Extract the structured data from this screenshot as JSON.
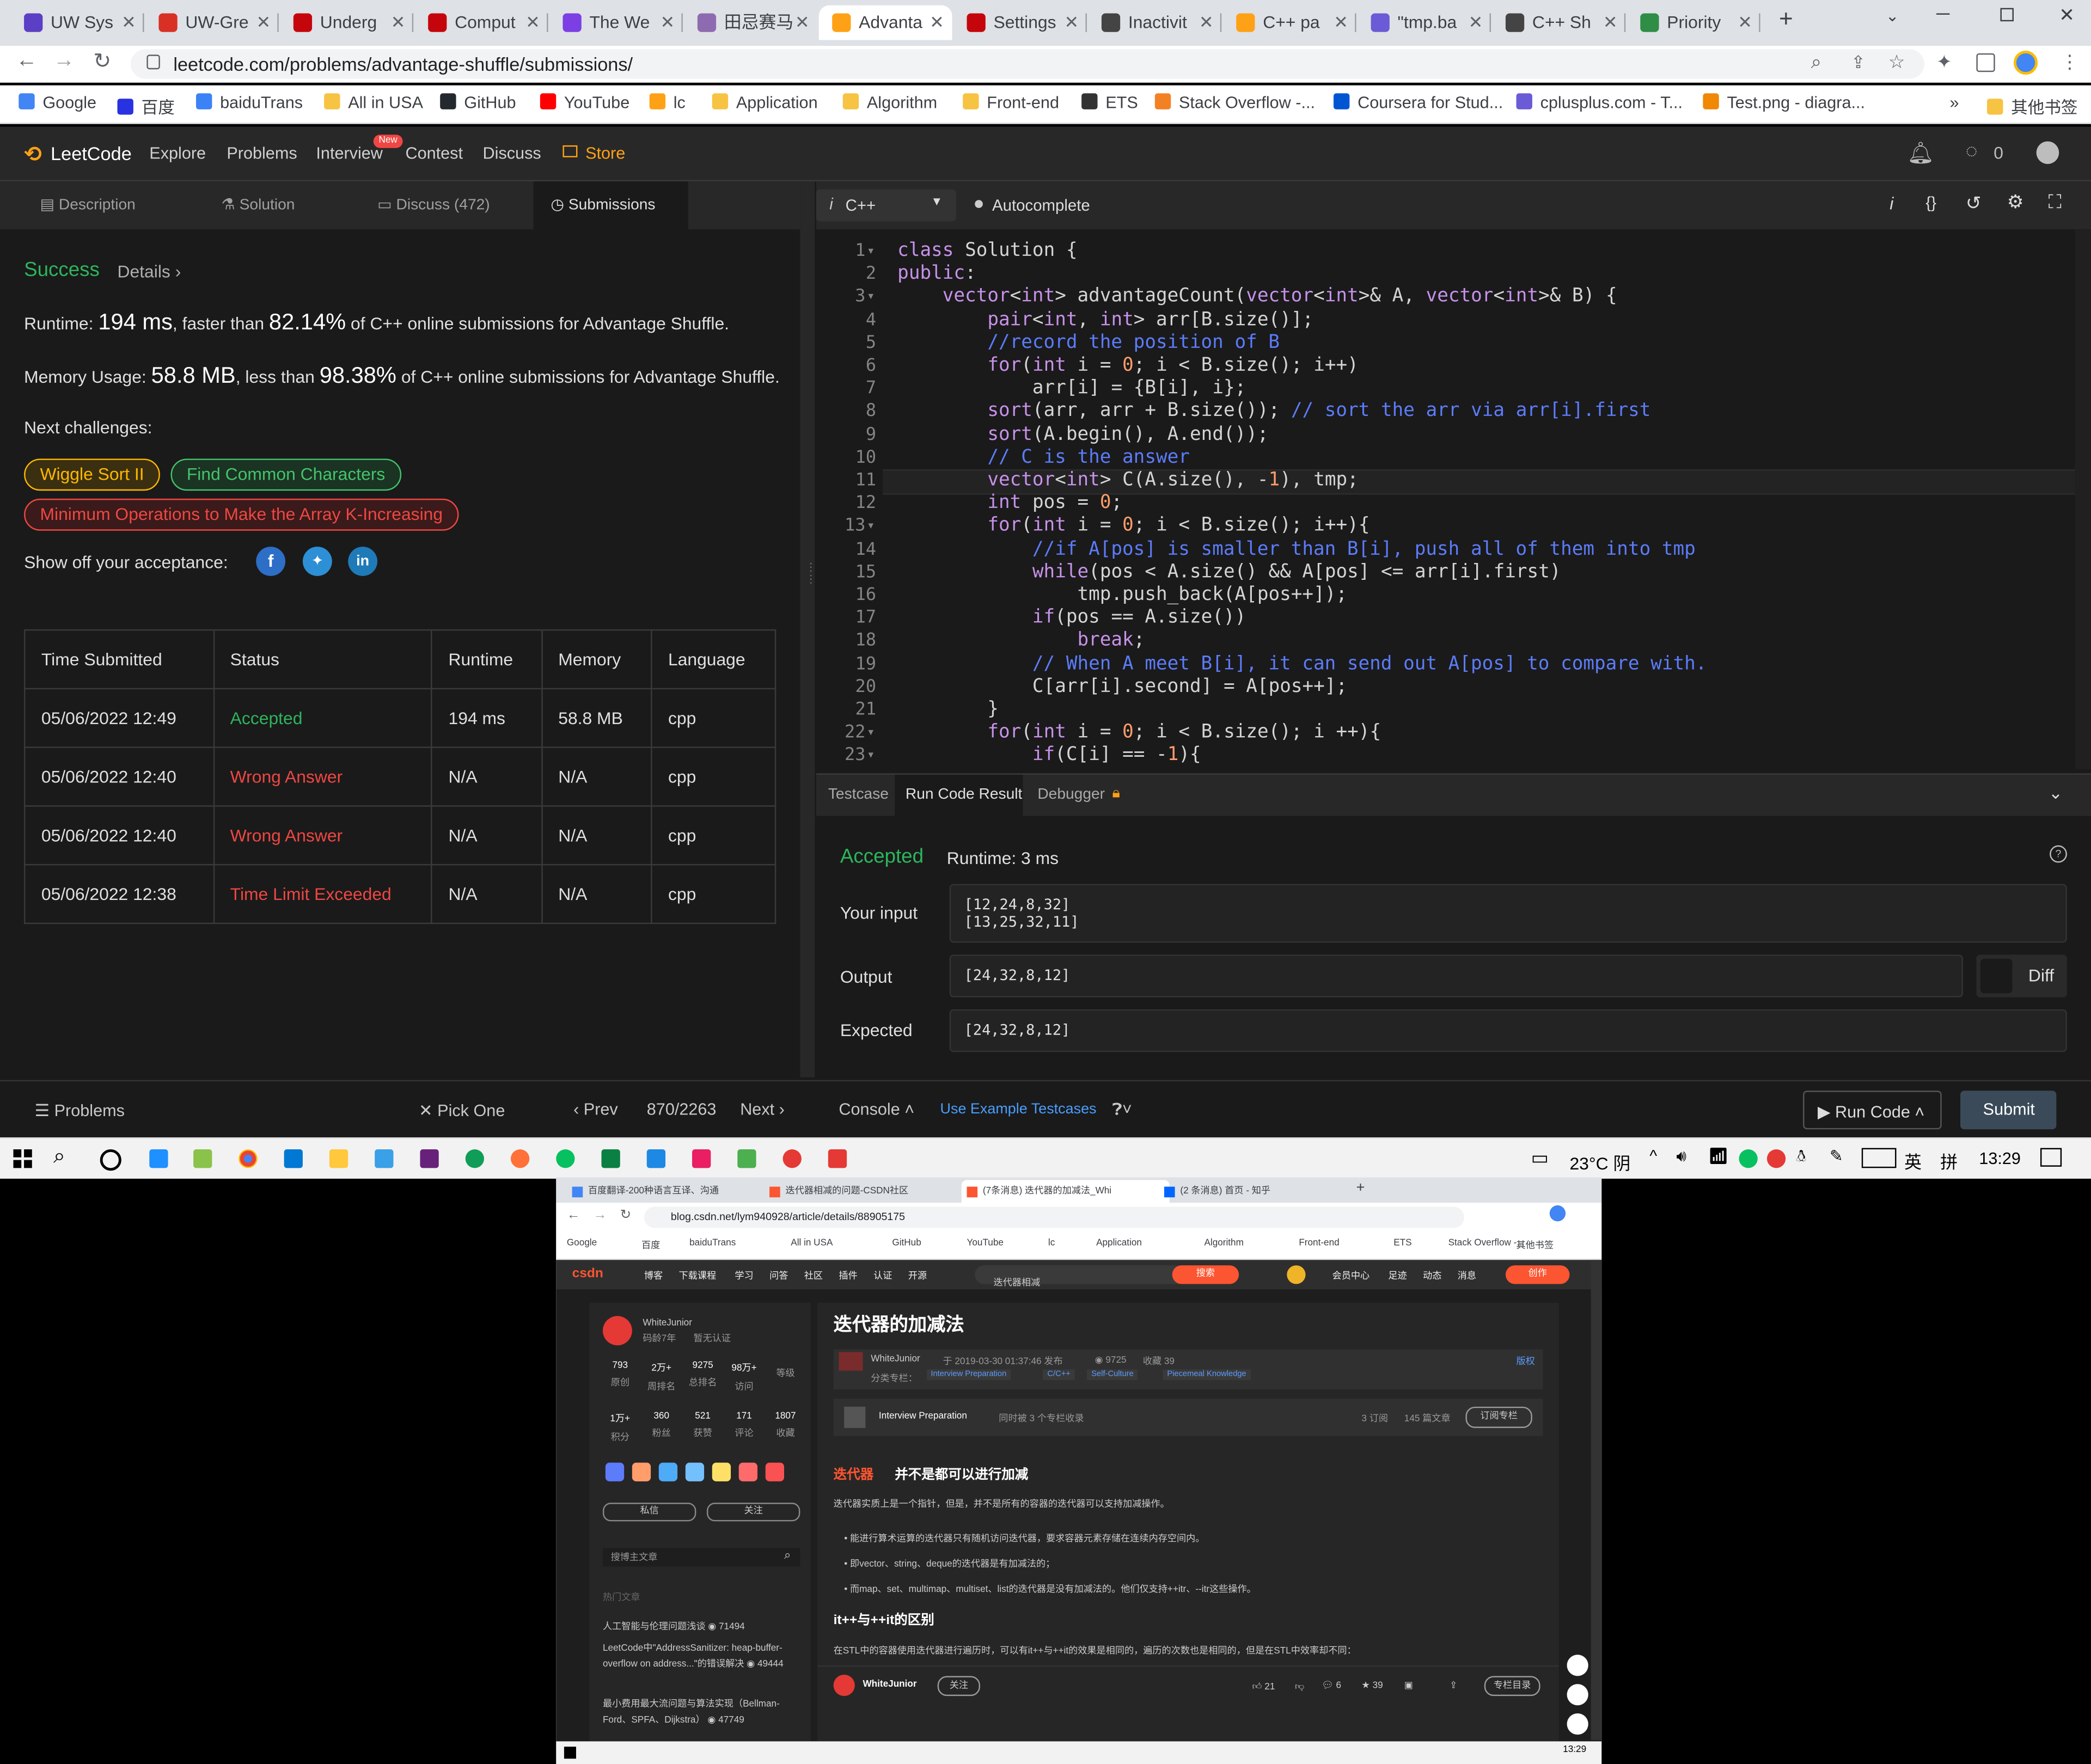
{
  "browser": {
    "tabs": [
      {
        "label": "UW Sys",
        "color": "#5b3fc4"
      },
      {
        "label": "UW-Gre",
        "color": "#d93025"
      },
      {
        "label": "Underg",
        "color": "#c5050c"
      },
      {
        "label": "Comput",
        "color": "#c5050c"
      },
      {
        "label": "The We",
        "color": "#7b3fe4"
      },
      {
        "label": "田忌赛马",
        "color": "#8e6bb0"
      },
      {
        "label": "Advanta",
        "color": "#ffa116"
      },
      {
        "label": "Settings",
        "color": "#c5050c"
      },
      {
        "label": "Inactivit",
        "color": "#444"
      },
      {
        "label": "C++ pa",
        "color": "#ffa116"
      },
      {
        "label": "\"tmp.ba",
        "color": "#6b5bd6"
      },
      {
        "label": "C++ Sh",
        "color": "#444"
      },
      {
        "label": "Priority",
        "color": "#2f8d46"
      }
    ],
    "url": "leetcode.com/problems/advantage-shuffle/submissions/",
    "bookmarks": [
      "Google",
      "百度",
      "baiduTrans",
      "All in USA",
      "GitHub",
      "YouTube",
      "lc",
      "Application",
      "Algorithm",
      "Front-end",
      "ETS",
      "Stack Overflow -...",
      "Coursera for Stud...",
      "cplusplus.com - T...",
      "Test.png - diagra..."
    ],
    "bookmarks_more": "»",
    "other_bookmarks": "其他书签"
  },
  "lc": {
    "logo": "LeetCode",
    "nav": [
      "Explore",
      "Problems",
      "Interview",
      "Contest",
      "Discuss"
    ],
    "new_badge": "New",
    "store": "Store",
    "coins": "0",
    "left_tabs": [
      "Description",
      "Solution",
      "Discuss (472)",
      "Submissions"
    ],
    "success": "Success",
    "details": "Details",
    "details_chev": "›",
    "runtime_label": "Runtime:",
    "runtime_value": "194 ms",
    "runtime_mid": ", faster than",
    "runtime_pct": "82.14%",
    "runtime_tail": "of C++ online submissions for Advantage Shuffle.",
    "memory_label": "Memory Usage:",
    "memory_value": "58.8 MB",
    "memory_mid": ", less than",
    "memory_pct": "98.38%",
    "memory_tail": "of C++ online submissions for Advantage Shuffle.",
    "next_challenges": "Next challenges:",
    "challenges": [
      "Wiggle Sort II",
      "Find Common Characters",
      "Minimum Operations to Make the Array K-Increasing"
    ],
    "show_off": "Show off your acceptance:",
    "table_headers": [
      "Time Submitted",
      "Status",
      "Runtime",
      "Memory",
      "Language"
    ],
    "rows": [
      {
        "time": "05/06/2022 12:49",
        "status": "Accepted",
        "runtime": "194 ms",
        "memory": "58.8 MB",
        "lang": "cpp"
      },
      {
        "time": "05/06/2022 12:40",
        "status": "Wrong Answer",
        "runtime": "N/A",
        "memory": "N/A",
        "lang": "cpp"
      },
      {
        "time": "05/06/2022 12:40",
        "status": "Wrong Answer",
        "runtime": "N/A",
        "memory": "N/A",
        "lang": "cpp"
      },
      {
        "time": "05/06/2022 12:38",
        "status": "Time Limit Exceeded",
        "runtime": "N/A",
        "memory": "N/A",
        "lang": "cpp"
      }
    ],
    "language": "C++",
    "autocomplete": "Autocomplete",
    "code_lines": [
      "class Solution {",
      "public:",
      "    vector<int> advantageCount(vector<int>& A, vector<int>& B) {",
      "        pair<int, int> arr[B.size()];",
      "        //record the position of B",
      "        for(int i = 0; i < B.size(); i++)",
      "            arr[i] = {B[i], i};",
      "        sort(arr, arr + B.size()); // sort the arr via arr[i].first",
      "        sort(A.begin(), A.end());",
      "        // C is the answer",
      "        vector<int> C(A.size(), -1), tmp;",
      "        int pos = 0;",
      "        for(int i = 0; i < B.size(); i++){",
      "            //if A[pos] is smaller than B[i], push all of them into tmp",
      "            while(pos < A.size() && A[pos] <= arr[i].first)",
      "                tmp.push_back(A[pos++]);",
      "            if(pos == A.size())",
      "                break;",
      "            // When A meet B[i], it can send out A[pos] to compare with.",
      "            C[arr[i].second] = A[pos++];",
      "        }",
      "        for(int i = 0; i < B.size(); i ++){",
      "            if(C[i] == -1){"
    ],
    "fold_lines": [
      1,
      3,
      13,
      22,
      23
    ],
    "result_tabs": [
      "Testcase",
      "Run Code Result",
      "Debugger"
    ],
    "result_status": "Accepted",
    "result_runtime": "Runtime: 3 ms",
    "your_input_label": "Your input",
    "your_input": "[12,24,8,32]\n[13,25,32,11]",
    "output_label": "Output",
    "output": "[24,32,8,12]",
    "diff": "Diff",
    "expected_label": "Expected",
    "expected": "[24,32,8,12]",
    "bottom": {
      "problems": "Problems",
      "pick_one": "Pick One",
      "prev": "Prev",
      "counter": "870/2263",
      "next": "Next",
      "console": "Console",
      "use_example": "Use Example Testcases",
      "run_code": "Run Code",
      "submit": "Submit"
    }
  },
  "taskbar": {
    "weather": "23°C 阴",
    "ime1": "英",
    "ime2": "拼",
    "time": "13:29"
  },
  "screen2": {
    "tabs": [
      "百度翻译-200种语言互译、沟通",
      "迭代器相减的问题-CSDN社区",
      "(7条消息) 迭代器的加减法_Whi",
      "(2 条消息) 首页 - 知乎"
    ],
    "url": "blog.csdn.net/lym940928/article/details/88905175",
    "bookmarks": [
      "Google",
      "百度",
      "baiduTrans",
      "All in USA",
      "GitHub",
      "YouTube",
      "lc",
      "Application",
      "Algorithm",
      "Front-end",
      "ETS",
      "Stack Overflow -...",
      "其他书签"
    ],
    "nav": [
      "博客",
      "下载课程",
      "学习",
      "问答",
      "社区",
      "插件",
      "认证",
      "开源"
    ],
    "search_placeholder": "迭代器相减",
    "search_btn": "搜索",
    "right_nav": [
      "会员中心",
      "足迹",
      "动态",
      "消息"
    ],
    "publish": "创作",
    "author": "WhiteJunior",
    "author_sub": "码龄7年",
    "verified": "暂无认证",
    "stats1": [
      {
        "v": "793",
        "l": "原创"
      },
      {
        "v": "2万+",
        "l": "周排名"
      },
      {
        "v": "9275",
        "l": "总排名"
      },
      {
        "v": "98万+",
        "l": "访问"
      },
      {
        "v": "",
        "l": "等级"
      }
    ],
    "stats2": [
      {
        "v": "1万+",
        "l": "积分"
      },
      {
        "v": "360",
        "l": "粉丝"
      },
      {
        "v": "521",
        "l": "获赞"
      },
      {
        "v": "171",
        "l": "评论"
      },
      {
        "v": "1807",
        "l": "收藏"
      }
    ],
    "msg_btn": "私信",
    "follow_btn": "关注",
    "search_article": "搜博主文章",
    "hot_label": "热门文章",
    "hot": [
      "人工智能与伦理问题浅谈",
      "LeetCode中\"AddressSanitizer: heap-buffer-overflow on address...\"的错误解决",
      "最小费用最大流问题与算法实现（Bellman-Ford、SPFA、Dijkstra）"
    ],
    "hot_views": [
      "71494",
      "49444",
      "47749"
    ],
    "title": "迭代器的加减法",
    "meta_author": "WhiteJunior",
    "meta_time": "于 2019-03-30 01:37:46 发布",
    "meta_views": "9725",
    "meta_fav": "收藏 39",
    "meta_copy": "版权",
    "categories_label": "分类专栏：",
    "categories": [
      "Interview Preparation",
      "C/C++",
      "Self-Culture",
      "Piecemeal Knowledge"
    ],
    "column_name": "Interview Preparation",
    "column_sub": "同时被 3 个专栏收录",
    "column_subs": "3 订阅",
    "column_articles": "145 篇文章",
    "column_btn": "订阅专栏",
    "h1_link": "迭代器",
    "h1_rest": "并不是都可以进行加减",
    "p1": "迭代器实质上是一个指针，但是，并不是所有的容器的迭代器可以支持加减操作。",
    "bullets": [
      "能进行算术运算的迭代器只有随机访问迭代器，要求容器元素存储在连续内存空间内。",
      "即vector、string、deque的迭代器是有加减法的；",
      "而map、set、multimap、multiset、list的迭代器是没有加减法的。他们仅支持++itr、--itr这些操作。"
    ],
    "h2": "it++与++it的区别",
    "p2": "在STL中的容器使用迭代器进行遍历时，可以有it++与++it的效果是相同的，遍历的次数也是相同的，但是在STL中效率却不同：",
    "bottom_author": "WhiteJunior",
    "bottom_follow": "关注",
    "likes": "21",
    "comments": "6",
    "favs": "39",
    "toc": "专栏目录",
    "time": "13:29"
  }
}
